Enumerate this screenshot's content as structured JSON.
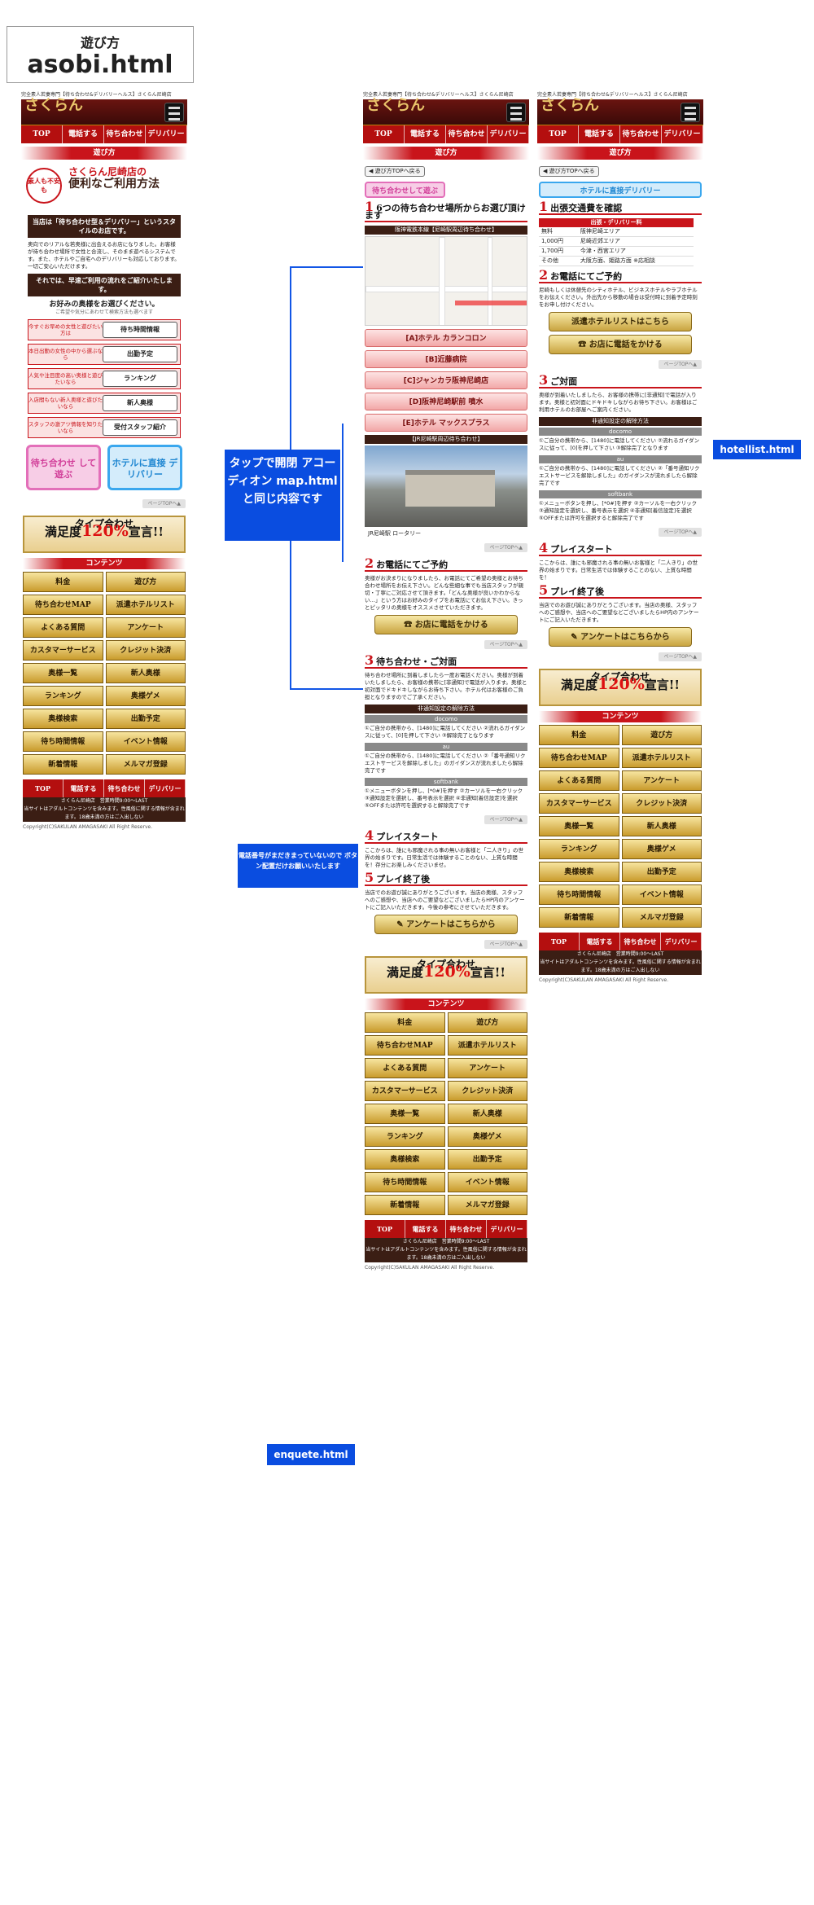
{
  "title": {
    "line1": "遊び方",
    "line2": "asobi.html"
  },
  "header": {
    "strip": "完全素人若妻専門【待ち合わせ&デリバリーヘルス】さくらん尼崎店",
    "logo": "さくらん",
    "nav": [
      "TOP",
      "電話する",
      "待ち合わせ",
      "デリバリー"
    ]
  },
  "section_title": "遊び方",
  "left": {
    "badge": "素人も不安も",
    "headline1": "さくらん尼崎店の",
    "headline2": "便利なご利用方法",
    "intro_box": "当店は「待ち合わせ型＆デリバリー」というスタイルのお店です。",
    "intro_text": "奥向でのリアルな若奥様に出会えるお店になりました。お客様が待ち合わせ場所で女性と合流し、そのまま遊べるシステムです。また、ホテルやご自宅へのデリバリーも対応しております。一切ご安心いただけます。",
    "explain_box": "それでは、早速ご利用の流れをご紹介いたします。",
    "choose_title": "お好みの奥様をお選びください。",
    "choose_sub": "ご希望や気分にあわせて検索方法も選べます",
    "options": [
      {
        "q": "今すぐお早めの女性と遊びたい方は",
        "a": "待ち時間情報"
      },
      {
        "q": "本日出勤の女性の中から選ぶなら",
        "a": "出勤予定"
      },
      {
        "q": "人気や注目度の高い奥様と遊びたいなら",
        "a": "ランキング"
      },
      {
        "q": "入店間もない新人奥様と遊びたいなら",
        "a": "新人奥様"
      },
      {
        "q": "スタッフの激アツ情報を知りたいなら",
        "a": "受付スタッフ紹介"
      }
    ],
    "btn_pink": "待ち合わせ して遊ぶ",
    "btn_blue": "ホテルに直接 デリバリー"
  },
  "page_top": "ページTOPへ▲",
  "back_btn": "◀ 遊び方TOPへ戻る",
  "tab_meet": "待ち合わせして遊ぶ",
  "tab_delivery": "ホテルに直接デリバリー",
  "mid": {
    "step1": "6つの待ち合わせ場所からお選び頂けます",
    "map_title": "阪神電鉄本線【尼崎駅周辺待ち合わせ】",
    "spots": [
      "[A]ホテル カランコロン",
      "[B]近藤病院",
      "[C]ジャンカラ阪神尼崎店",
      "[D]阪神尼崎駅前 噴水",
      "[E]ホテル マックスプラス"
    ],
    "jr_title": "【JR尼崎駅周辺待ち合わせ】",
    "jr_caption": "JR尼崎駅 ロータリー",
    "step2": "お電話にてご予約",
    "step2_text": "奥様がお決まりになりましたら、お電話にてご希望の奥様とお待ち合わせ場所をお伝え下さい。どんな些細な事でも当店スタッフが親切・丁寧にご対応させて頂きます。「どんな奥様が良いかわからない…」という方はお好みのタイプをお電話にてお伝え下さい。きっとピッタリの奥様をオススメさせていただきます。",
    "call_btn": "お店に電話をかける",
    "step3": "待ち合わせ・ご対面",
    "step3_text": "待ち合わせ場所に到着しましたら一度お電話ください。奥様が到着いたしましたら、お客様の携帯に[非通知]で電話が入ります。奥様と初対面でドキドキしながらお待ち下さい。ホテル代はお客様のご負担となりますのでご了承ください。",
    "hide_title": "非通知設定の解除方法",
    "carriers": [
      "docomo",
      "au",
      "softbank"
    ],
    "docomo_text": "①ご自分の携帯から、[1480]に電話してください ②流れるガイダンスに従って、[0]を押して下さい ③解除完了となります",
    "au_text": "①ご自分の携帯から、[1480]に電話してください ②「番号通知リクエストサービスを解除しました」のガイダンスが流れましたら解除完了です",
    "softbank_text": "①メニューボタンを押し、[*0#]を押す ②カーソルを一右クリック ③通知設定を選択し、番号表示を選択 ④非通知[着信設定]を選択 ⑤OFFまたは許可を選択すると解除完了です",
    "step4": "プレイスタート",
    "step4_text": "ここからは、誰にも邪魔される事の無いお客様と「二人きり」の世界の始まりです。日常生活では体験することのない、上質な時間を！存分にお楽しみくださいませ。",
    "step5": "プレイ終了後",
    "step5_text": "当店でのお遊び誠にありがとうございます。当店の奥様、スタッフへのご感想や、当店へのご要望などございましたらHP内のアンケートにご記入いただきます。今後の参考にさせていただきます。",
    "enquete_btn": "アンケートはこちらから"
  },
  "right": {
    "step1": "出張交通費を確認",
    "price_header": "出張・デリバリー料",
    "prices": [
      {
        "fee": "無料",
        "area": "阪神尼崎エリア"
      },
      {
        "fee": "1,000円",
        "area": "尼崎近郊エリア"
      },
      {
        "fee": "1,700円",
        "area": "今津・西宮エリア"
      },
      {
        "fee": "その他",
        "area": "大阪方面、姫路方面 ※応相談"
      }
    ],
    "step2": "お電話にてご予約",
    "step2_text": "尼崎もしくは休憩先のシティホテル、ビジネスホテルやラブホテルをお伝えください。外出先から移動の場合は受付時に到着予定時刻をお申し付けください。",
    "hotellist_btn": "派遣ホテルリストはこちら",
    "call_btn": "お店に電話をかける",
    "step3": "ご対面",
    "step3_text": "奥様が到着いたしましたら、お客様の携帯に[非通知]で電話が入ります。奥様と初対面にドキドキしながらお待ち下さい。お客様はご利用ホテルのお部屋へご案内ください。",
    "step4": "プレイスタート",
    "step4_text": "ここからは、誰にも邪魔される事の無いお客様と「二人きり」の世界の始まりです。日常生活では体験することのない、上質な時間を！",
    "step5": "プレイ終了後",
    "step5_text": "当店でのお遊び誠にありがとうございます。当店の奥様、スタッフへのご感想や、当店へのご要望などございましたらHP内のアンケートにご記入いただきます。"
  },
  "satisfaction": {
    "line1": "タイプ合わせ",
    "pre": "満足度",
    "num": "120%",
    "post": "宣言!!"
  },
  "contents_title": "コンテンツ",
  "contents": [
    "料金",
    "遊び方",
    "待ち合わせMAP",
    "派遣ホテルリスト",
    "よくある質問",
    "アンケート",
    "カスタマーサービス",
    "クレジット決済",
    "奥様一覧",
    "新人奥様",
    "ランキング",
    "奥様ゲメ",
    "奥様検索",
    "出勤予定",
    "待ち時間情報",
    "イベント情報",
    "新着情報",
    "メルマガ登録"
  ],
  "footer": {
    "nav": [
      "TOP",
      "電話する",
      "待ち合わせ",
      "デリバリー"
    ],
    "shop": "さくらん尼崎店　営業時間9:00〜LAST",
    "note": "当サイトはアダルトコンテンツを含みます。性風俗に関する情報が含まれます。18歳未満の方はご入出しない",
    "copyright": "Copyright(C)SAKULAN AMAGASAKI All Right Reserve."
  },
  "annotations": {
    "accordion": "タップで開閉 アコーディオン map.htmlと同じ内容です",
    "phone": "電話番号がまだきまっていないので ボタン配置だけお願いいたします",
    "hotellist": "hotellist.html",
    "enquete": "enquete.html"
  }
}
